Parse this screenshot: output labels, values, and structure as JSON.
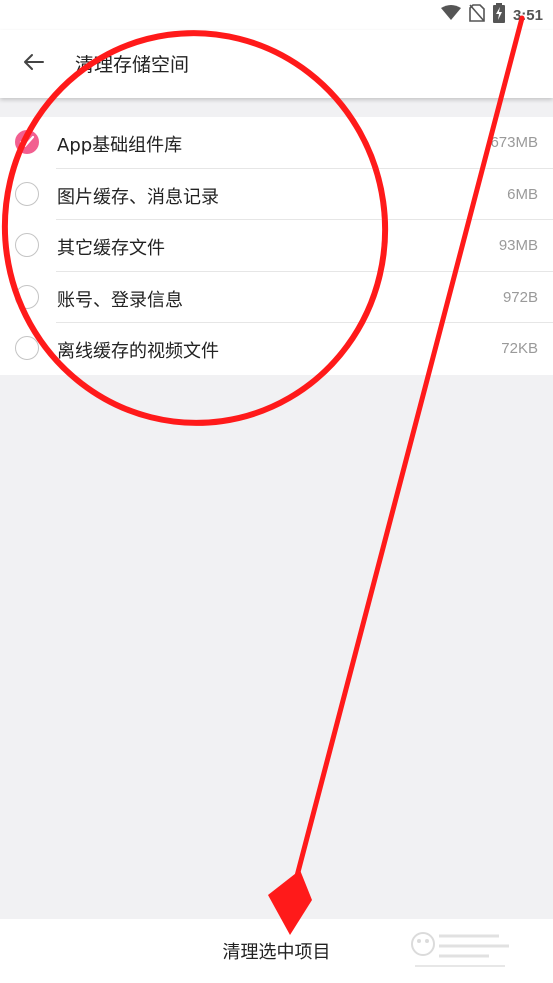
{
  "status_bar": {
    "time": "3:51",
    "icons": [
      "wifi-icon",
      "no-sim-icon",
      "battery-charging-icon"
    ]
  },
  "app_bar": {
    "back_icon": "arrow-left-icon",
    "title": "清理存储空间"
  },
  "items": [
    {
      "label": "App基础组件库",
      "size": "673MB",
      "checked": true
    },
    {
      "label": "图片缓存、消息记录",
      "size": "6MB",
      "checked": false
    },
    {
      "label": "其它缓存文件",
      "size": "93MB",
      "checked": false
    },
    {
      "label": "账号、登录信息",
      "size": "972B",
      "checked": false
    },
    {
      "label": "离线缓存的视频文件",
      "size": "72KB",
      "checked": false
    }
  ],
  "bottom": {
    "clean_label": "清理选中项目"
  },
  "colors": {
    "accent": "#f25f90",
    "annotation_red": "#ff1a1a",
    "background": "#f1f1f3"
  }
}
